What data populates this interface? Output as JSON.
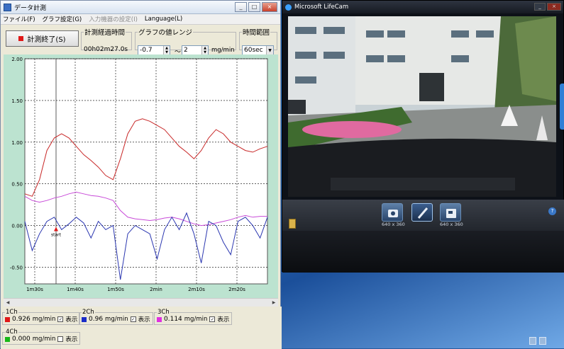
{
  "app": {
    "title": "データ計測",
    "menu": [
      {
        "label": "ファイル(F)",
        "enabled": true
      },
      {
        "label": "グラフ設定(G)",
        "enabled": true
      },
      {
        "label": "入力機器の設定(I)",
        "enabled": false
      },
      {
        "label": "Language(L)",
        "enabled": true
      }
    ]
  },
  "toolbar": {
    "stop_label": "計測終了(S)",
    "elapsed_legend": "計測経過時間",
    "elapsed_value": "00h02m27.0s",
    "range_legend": "グラフの値レンジ",
    "range_min": "-0.7",
    "range_sep": "～",
    "range_max": "2",
    "range_unit": "mg/min",
    "time_legend": "時間範囲",
    "time_value": "60sec"
  },
  "chart_data": {
    "type": "line",
    "ylim": [
      -0.7,
      2.0
    ],
    "y_ticks": [
      "2.00",
      "1.50",
      "1.00",
      "0.50",
      "0.00",
      "-0.50"
    ],
    "x_ticks": [
      "1m30s",
      "1m40s",
      "1m50s",
      "2min",
      "2m10s",
      "2m20s"
    ],
    "annotation": "start",
    "series": [
      {
        "color": "#c82828",
        "values": [
          0.38,
          0.35,
          0.55,
          0.9,
          1.05,
          1.1,
          1.05,
          0.95,
          0.85,
          0.78,
          0.7,
          0.6,
          0.55,
          0.8,
          1.1,
          1.25,
          1.28,
          1.25,
          1.2,
          1.15,
          1.05,
          0.95,
          0.88,
          0.8,
          0.9,
          1.05,
          1.15,
          1.1,
          1.0,
          0.95,
          0.9,
          0.88,
          0.92,
          0.95
        ]
      },
      {
        "color": "#c84ad8",
        "values": [
          0.35,
          0.3,
          0.28,
          0.3,
          0.33,
          0.35,
          0.38,
          0.4,
          0.38,
          0.36,
          0.35,
          0.33,
          0.3,
          0.18,
          0.1,
          0.08,
          0.07,
          0.06,
          0.07,
          0.09,
          0.1,
          0.08,
          0.05,
          0.02,
          0.0,
          0.01,
          0.03,
          0.05,
          0.07,
          0.1,
          0.12,
          0.1,
          0.11,
          0.11
        ]
      },
      {
        "color": "#2a36b0",
        "values": [
          0.05,
          -0.3,
          -0.1,
          0.05,
          0.1,
          -0.05,
          0.02,
          0.1,
          0.03,
          -0.15,
          0.05,
          -0.05,
          0.0,
          -0.65,
          -0.1,
          0.0,
          -0.05,
          -0.1,
          -0.4,
          -0.05,
          0.1,
          -0.05,
          0.15,
          -0.1,
          -0.45,
          0.05,
          0.0,
          -0.2,
          -0.35,
          0.05,
          0.1,
          0.0,
          -0.15,
          0.1
        ]
      }
    ]
  },
  "channels": [
    {
      "legend": "1Ch",
      "color": "#e01818",
      "value": "0.926",
      "unit": "mg/min",
      "show_label": "表示",
      "checked": true
    },
    {
      "legend": "2Ch",
      "color": "#1a2cc8",
      "value": "0.96",
      "unit": "mg/min",
      "show_label": "表示",
      "checked": true
    },
    {
      "legend": "3Ch",
      "color": "#e030e0",
      "value": "0.114",
      "unit": "mg/min",
      "show_label": "表示",
      "checked": true
    },
    {
      "legend": "4Ch",
      "color": "#18b818",
      "value": "0.000",
      "unit": "mg/min",
      "show_label": "表示",
      "checked": false
    }
  ],
  "camera": {
    "title": "Microsoft LifeCam",
    "photo_res": "640 x 360",
    "video_res": "640 x 360",
    "help": "?"
  },
  "winbtn": {
    "min": "_",
    "max": "□",
    "close": "×"
  }
}
